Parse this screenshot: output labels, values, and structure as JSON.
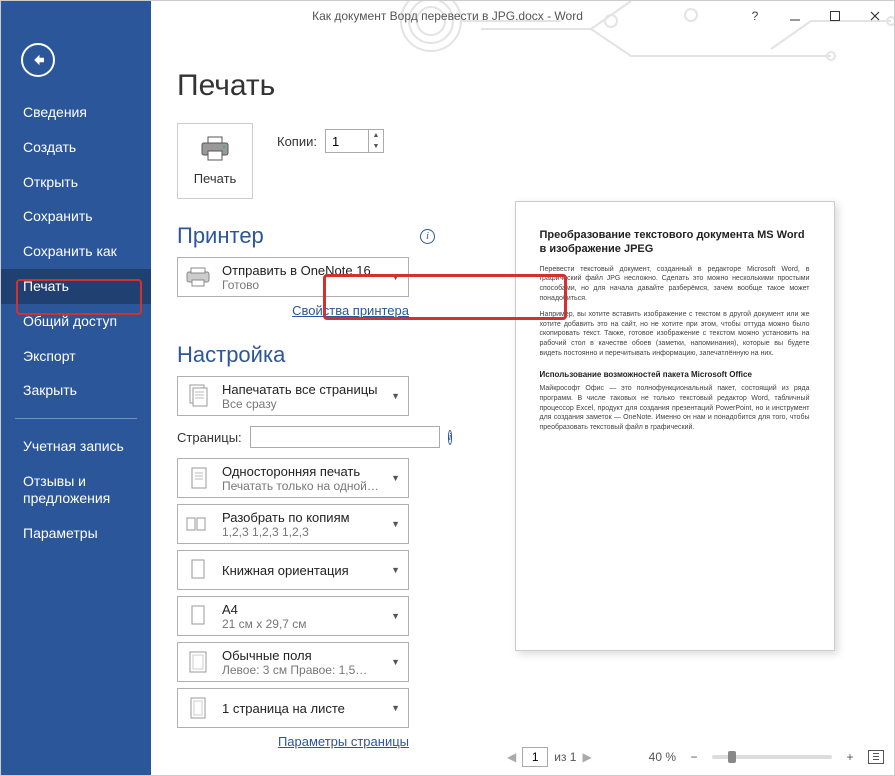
{
  "window": {
    "title": "Как документ Ворд перевести в JPG.docx  -  Word",
    "help": "?"
  },
  "sidebar": {
    "items": [
      "Сведения",
      "Создать",
      "Открыть",
      "Сохранить",
      "Сохранить как",
      "Печать",
      "Общий доступ",
      "Экспорт",
      "Закрыть"
    ],
    "group2": [
      "Учетная запись",
      "Отзывы и предложения",
      "Параметры"
    ],
    "active_index": 5
  },
  "page": {
    "title": "Печать",
    "print_button": "Печать",
    "copies_label": "Копии:",
    "copies_value": "1"
  },
  "printer": {
    "heading": "Принтер",
    "name": "Отправить в OneNote 16",
    "status": "Готово",
    "properties_link": "Свойства принтера"
  },
  "settings": {
    "heading": "Настройка",
    "print_range": {
      "l1": "Напечатать все страницы",
      "l2": "Все сразу"
    },
    "pages_label": "Страницы:",
    "pages_value": "",
    "duplex": {
      "l1": "Односторонняя печать",
      "l2": "Печатать только на одной…"
    },
    "collate": {
      "l1": "Разобрать по копиям",
      "l2": "1,2,3    1,2,3    1,2,3"
    },
    "orientation": {
      "l1": "Книжная ориентация",
      "l2": ""
    },
    "paper": {
      "l1": "A4",
      "l2": "21 см x 29,7 см"
    },
    "margins": {
      "l1": "Обычные поля",
      "l2": "Левое: 3 см  Правое: 1,5…"
    },
    "per_sheet": {
      "l1": "1 страница на листе",
      "l2": ""
    },
    "page_setup_link": "Параметры страницы"
  },
  "preview": {
    "h1": "Преобразование текстового документа MS Word в изображение JPEG",
    "p1": "Перевести текстовый документ, созданный в редакторе Microsoft Word, в графический файл JPG несложно. Сделать это можно несколькими простыми способами, но для начала давайте разберёмся, зачем вообще такое может понадобиться.",
    "p2": "Например, вы хотите вставить изображение с текстом в другой документ или же хотите добавить это на сайт, но не хотите при этом, чтобы оттуда можно было скопировать текст. Также, готовое изображение с текстом можно установить на рабочий стол в качестве обоев (заметки, напоминания), которые вы будете видеть постоянно и перечитывать информацию, запечатлённую на них.",
    "h2": "Использование возможностей пакета Microsoft Office",
    "p3": "Майкрософт Офис — это полнофункциональный пакет, состоящий из ряда программ. В числе таковых не только текстовый редактор Word, табличный процессор Excel, продукт для создания презентаций PowerPoint, но и инструмент для создания заметок — OneNote. Именно он нам и понадобится для того, чтобы преобразовать текстовый файл в графический."
  },
  "footer": {
    "page_current": "1",
    "page_of": "из 1",
    "zoom_value": "40 %"
  }
}
